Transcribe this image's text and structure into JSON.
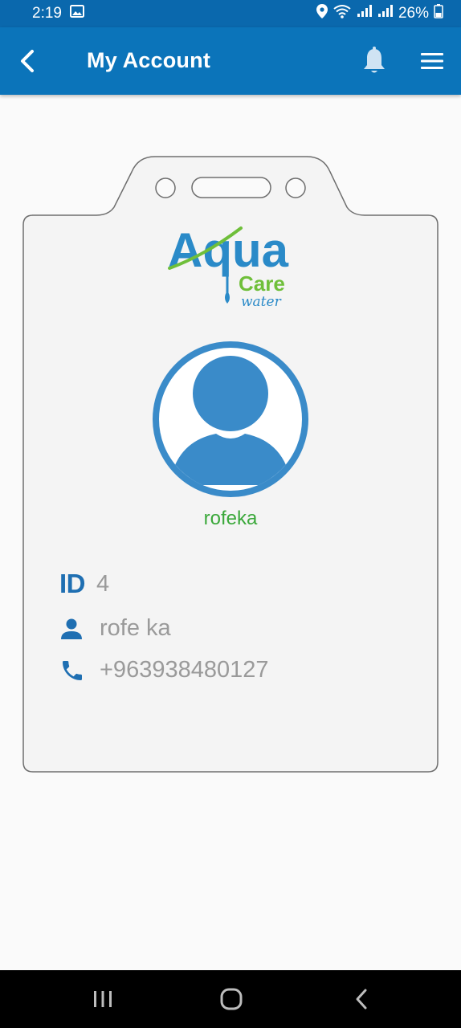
{
  "status_bar": {
    "time": "2:19",
    "battery": "26%",
    "icons": [
      "image-icon",
      "location-icon",
      "wifi-icon",
      "signal-icon",
      "signal-icon",
      "battery-icon"
    ]
  },
  "app_bar": {
    "title": "My Account",
    "icons": [
      "back-arrow-icon",
      "bell-icon",
      "hamburger-menu-icon"
    ]
  },
  "card": {
    "logo": {
      "line1": "Aqua",
      "line2": "Care",
      "line3": "water"
    },
    "username": "rofeka",
    "id_label": "ID",
    "id_value": "4",
    "name": "rofe ka",
    "phone": "+963938480127"
  },
  "colors": {
    "app_bar": "#0b74ba",
    "status_bar": "#0a68ad",
    "avatar_blue": "#3a8bc9",
    "username_green": "#3aa83a",
    "id_blue": "#1f6fb2",
    "value_gray": "#9a9a9a"
  }
}
